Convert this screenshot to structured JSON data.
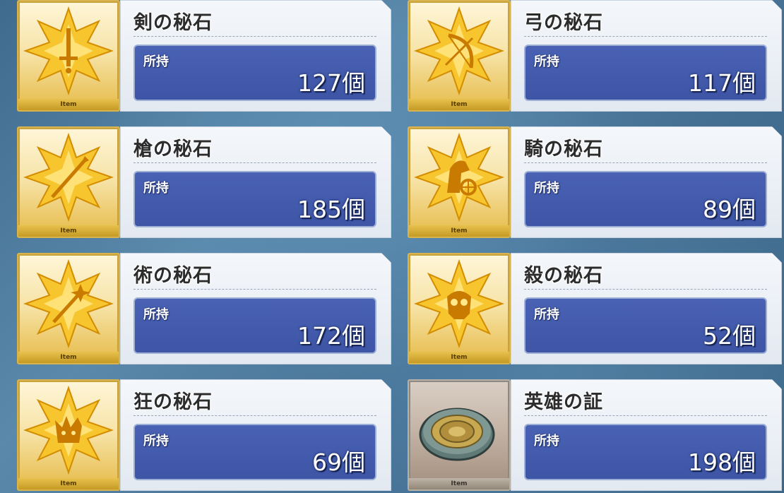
{
  "items": [
    {
      "name": "剣の秘石",
      "label": "所持",
      "count": "127個",
      "footer": "Item",
      "icon": "saber-star-icon",
      "kind": "gold"
    },
    {
      "name": "弓の秘石",
      "label": "所持",
      "count": "117個",
      "footer": "Item",
      "icon": "archer-star-icon",
      "kind": "gold"
    },
    {
      "name": "槍の秘石",
      "label": "所持",
      "count": "185個",
      "footer": "Item",
      "icon": "lancer-star-icon",
      "kind": "gold"
    },
    {
      "name": "騎の秘石",
      "label": "所持",
      "count": "89個",
      "footer": "Item",
      "icon": "rider-star-icon",
      "kind": "gold"
    },
    {
      "name": "術の秘石",
      "label": "所持",
      "count": "172個",
      "footer": "Item",
      "icon": "caster-star-icon",
      "kind": "gold"
    },
    {
      "name": "殺の秘石",
      "label": "所持",
      "count": "52個",
      "footer": "Item",
      "icon": "assassin-star-icon",
      "kind": "gold"
    },
    {
      "name": "狂の秘石",
      "label": "所持",
      "count": "69個",
      "footer": "Item",
      "icon": "berserker-star-icon",
      "kind": "gold"
    },
    {
      "name": "英雄の証",
      "label": "所持",
      "count": "198個",
      "footer": "Item",
      "icon": "hero-medal-icon",
      "kind": "bronze"
    }
  ],
  "colors": {
    "gold": "#e9c25a",
    "count_box": "#3e55a6",
    "panel": "#eef2f7"
  }
}
